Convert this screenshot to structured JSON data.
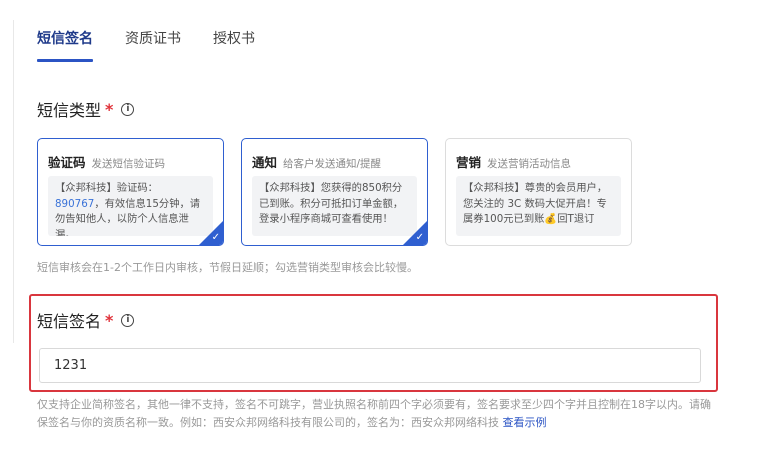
{
  "tabs": [
    {
      "label": "短信签名",
      "active": true
    },
    {
      "label": "资质证书",
      "active": false
    },
    {
      "label": "授权书",
      "active": false
    }
  ],
  "sms_type": {
    "title": "短信类型",
    "required_mark": "*",
    "info_icon": "i",
    "cards": [
      {
        "name": "验证码",
        "desc": "发送短信验证码",
        "body_prefix": "【众邦科技】验证码：",
        "body_highlight": "890767",
        "body_suffix": "，有效信息15分钟，请勿告知他人，以防个人信息泄漏。",
        "selected": true
      },
      {
        "name": "通知",
        "desc": "给客户发送通知/提醒",
        "body": "【众邦科技】您获得的850积分已到账。积分可抵扣订单金额，登录小程序商城可查看使用！",
        "selected": true
      },
      {
        "name": "营销",
        "desc": "发送营销活动信息",
        "body": "【众邦科技】尊贵的会员用户，您关注的 3C 数码大促开启！专属券100元已到账💰回T退订",
        "selected": false
      }
    ],
    "hint": "短信审核会在1-2个工作日内审核，节假日延顺；勾选营销类型审核会比较慢。"
  },
  "signature": {
    "title": "短信签名",
    "required_mark": "*",
    "info_icon": "i",
    "value": "1231",
    "help_text": "仅支持企业简称签名，其他一律不支持，签名不可跳字，营业执照名称前四个字必须要有，签名要求至少四个字并且控制在18字以内。请确保签名与你的资质名称一致。例如：西安众邦网络科技有限公司的，签名为：西安众邦网络科技",
    "example_link": "查看示例"
  },
  "colors": {
    "accent": "#2f5fd0",
    "required": "#e0323a",
    "highlight_border": "#d9363e",
    "link": "#2b54c4"
  }
}
